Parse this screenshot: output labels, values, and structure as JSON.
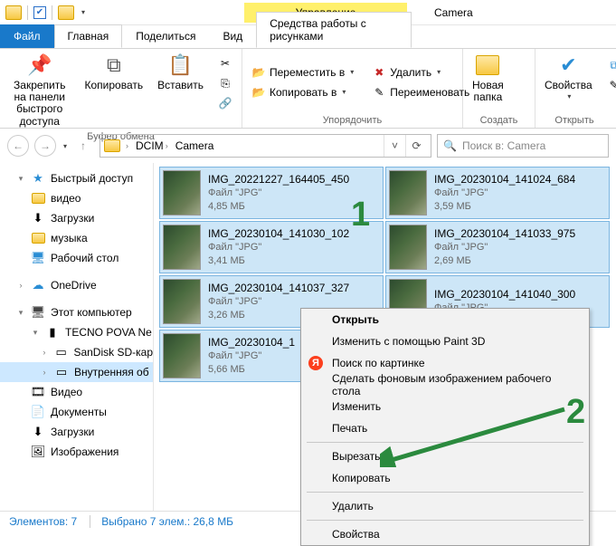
{
  "titlebar": {
    "manage": "Управление",
    "title": "Camera"
  },
  "tabs": {
    "file": "Файл",
    "home": "Главная",
    "share": "Поделиться",
    "view": "Вид",
    "context": "Средства работы с рисунками"
  },
  "ribbon": {
    "clipboard": {
      "pin": "Закрепить на панели\nбыстрого доступа",
      "copy": "Копировать",
      "paste": "Вставить",
      "label": "Буфер обмена"
    },
    "organize": {
      "move": "Переместить в",
      "copy_to": "Копировать в",
      "delete": "Удалить",
      "rename": "Переименовать",
      "label": "Упорядочить"
    },
    "new": {
      "folder": "Новая\nпапка",
      "label": "Создать"
    },
    "open": {
      "props": "Свойства",
      "label": "Открыть"
    }
  },
  "breadcrumb": {
    "dcim": "DCIM",
    "camera": "Camera"
  },
  "search": {
    "placeholder": "Поиск в: Camera"
  },
  "sidebar": {
    "quick": "Быстрый доступ",
    "video": "видео",
    "downloads": "Загрузки",
    "music": "музыка",
    "desktop": "Рабочий стол",
    "onedrive": "OneDrive",
    "pc": "Этот компьютер",
    "tecno": "TECNO POVA Ne",
    "sandisk": "SanDisk SD-кар",
    "internal": "Внутренняя об",
    "videos": "Видео",
    "documents": "Документы",
    "downloads2": "Загрузки",
    "images": "Изображения"
  },
  "files": [
    {
      "name": "IMG_20221227_164405_450",
      "type": "Файл \"JPG\"",
      "size": "4,85 МБ"
    },
    {
      "name": "IMG_20230104_141024_684",
      "type": "Файл \"JPG\"",
      "size": "3,59 МБ"
    },
    {
      "name": "IMG_20230104_141030_102",
      "type": "Файл \"JPG\"",
      "size": "3,41 МБ"
    },
    {
      "name": "IMG_20230104_141033_975",
      "type": "Файл \"JPG\"",
      "size": "2,69 МБ"
    },
    {
      "name": "IMG_20230104_141037_327",
      "type": "Файл \"JPG\"",
      "size": "3,26 МБ"
    },
    {
      "name": "IMG_20230104_141040_300",
      "type": "Файл \"JPG\"",
      "size": ""
    },
    {
      "name": "IMG_20230104_1",
      "type": "Файл \"JPG\"",
      "size": "5,66 МБ"
    }
  ],
  "context_menu": {
    "open": "Открыть",
    "paint3d": "Изменить с помощью Paint 3D",
    "yandex": "Поиск по картинке",
    "wallpaper": "Сделать фоновым изображением рабочего стола",
    "edit": "Изменить",
    "print": "Печать",
    "cut": "Вырезать",
    "copy": "Копировать",
    "delete": "Удалить",
    "props": "Свойства"
  },
  "status": {
    "count": "Элементов: 7",
    "selected": "Выбрано 7 элем.: 26,8 МБ"
  },
  "annotations": {
    "one": "1",
    "two": "2"
  }
}
